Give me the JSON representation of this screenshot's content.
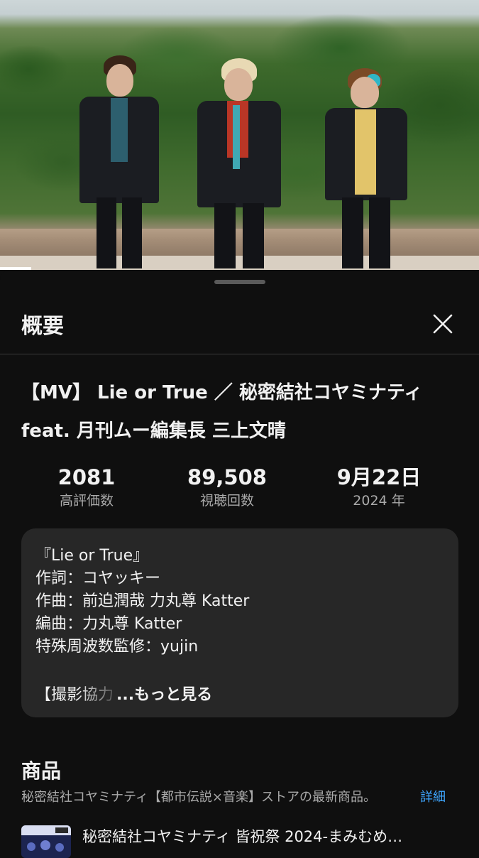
{
  "panel": {
    "title": "概要",
    "close_icon": "close-icon"
  },
  "video": {
    "title": "【MV】 Lie or True ／ 秘密結社コヤミナティ feat. 月刊ムー編集長 三上文晴",
    "progress_fraction": 0.065
  },
  "stats": [
    {
      "value": "2081",
      "label": "高評価数"
    },
    {
      "value": "89,508",
      "label": "視聴回数"
    },
    {
      "value": "9月22日",
      "label": "2024 年"
    }
  ],
  "description": {
    "lines": [
      "『Lie or True』",
      "作詞：コヤッキー",
      "作曲：前迫潤哉 力丸尊 Katter",
      "編曲：力丸尊 Katter",
      "特殊周波数監修：yujin"
    ],
    "truncated_line": "【撮影協力",
    "more_label": "...もっと見る"
  },
  "products": {
    "title": "商品",
    "subtitle": "秘密結社コヤミナティ【都市伝説×音楽】ストアの最新商品。",
    "detail_link": "詳細",
    "items": [
      {
        "name": "秘密結社コヤミナティ 皆祝祭 2024-まみむめ…"
      }
    ]
  },
  "colors": {
    "background": "#0f0f0f",
    "card": "#272727",
    "secondary_text": "#aaaaaa",
    "link": "#3ea6ff"
  }
}
